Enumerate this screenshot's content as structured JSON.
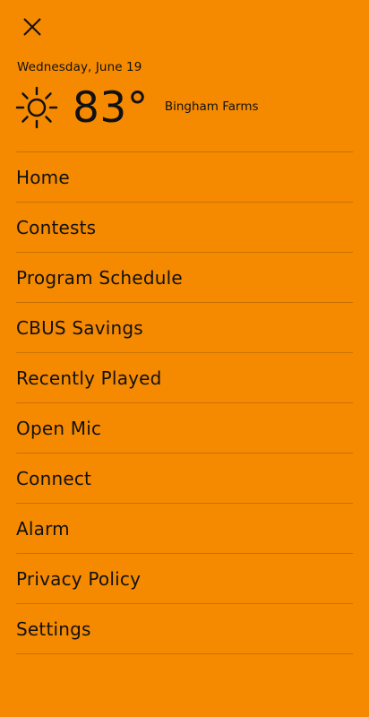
{
  "header": {
    "date": "Wednesday, June 19",
    "temperature": "83°",
    "location": "Bingham Farms"
  },
  "icons": {
    "close": "close-icon",
    "weather": "sun-icon"
  },
  "menu": {
    "items": [
      {
        "label": "Home"
      },
      {
        "label": "Contests"
      },
      {
        "label": "Program Schedule"
      },
      {
        "label": "CBUS Savings"
      },
      {
        "label": "Recently Played"
      },
      {
        "label": "Open Mic"
      },
      {
        "label": "Connect"
      },
      {
        "label": "Alarm"
      },
      {
        "label": "Privacy Policy"
      },
      {
        "label": "Settings"
      }
    ]
  },
  "colors": {
    "background": "#F58A00",
    "text": "#111111"
  }
}
